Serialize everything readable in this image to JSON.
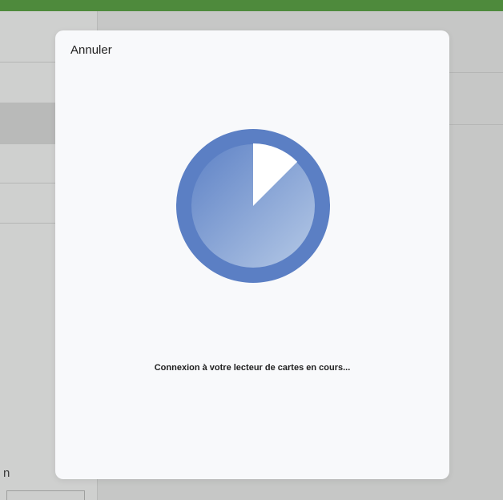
{
  "modal": {
    "cancel_label": "Annuler",
    "status_text": "Connexion à votre lecteur de cartes en cours...",
    "progress_fraction": 0.875
  },
  "background": {
    "partial_label": "n"
  },
  "colors": {
    "accent": "#5b7fc4",
    "top_bar": "#4e8a3c",
    "modal_bg": "#f8f9fb"
  }
}
